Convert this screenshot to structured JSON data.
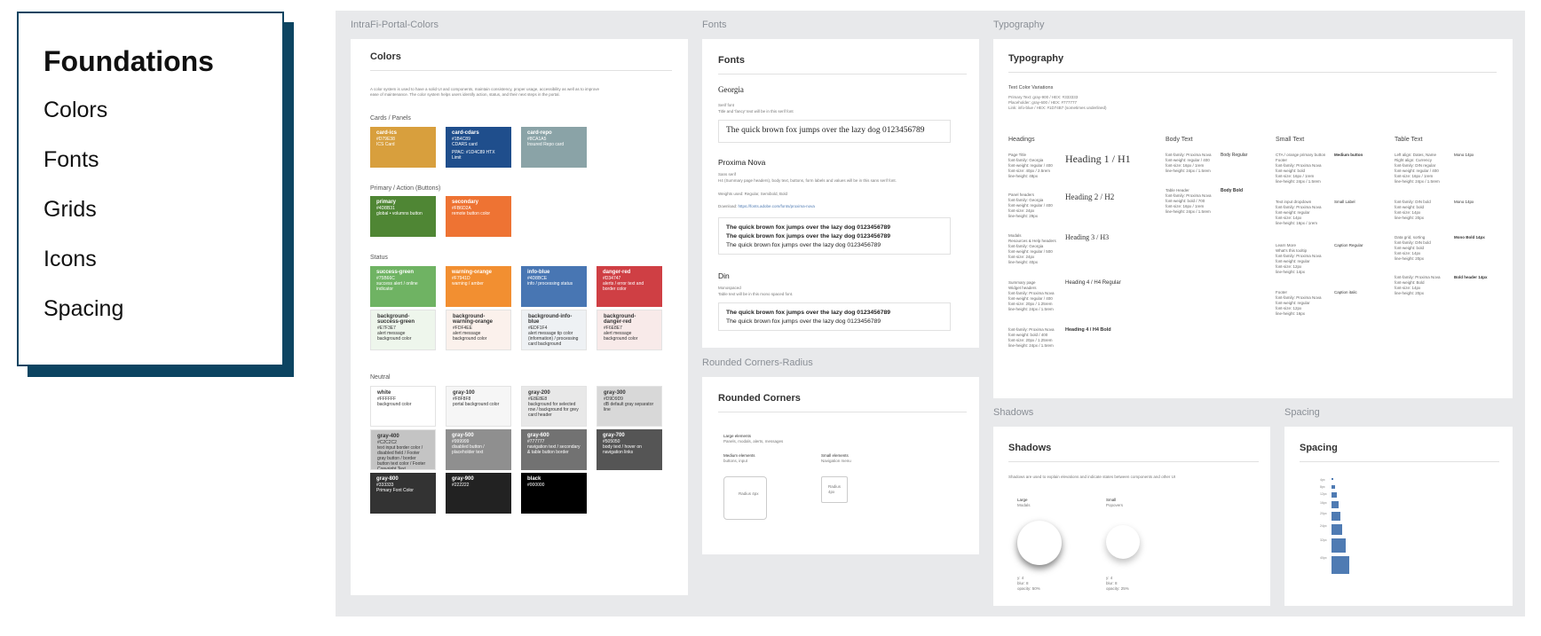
{
  "nav": {
    "title": "Foundations",
    "items": [
      "Colors",
      "Fonts",
      "Grids",
      "Icons",
      "Spacing"
    ]
  },
  "frames": {
    "colors": {
      "label": "IntraFi-Portal-Colors",
      "heading": "Colors",
      "intro": "A color system is used to have a solid UI and components, maintain consistency, proper usage, accessibility as well as to improve ease of maintenance. The color system helps users identify action, status, and their next steps in the portal.",
      "sections": {
        "cards": "Cards / Panels",
        "primary": "Primary / Action (Buttons)",
        "status": "Status",
        "neutral": "Neutral"
      },
      "cards": [
        {
          "name": "card-ics",
          "hex": "#D79E38",
          "note": "ICS Card",
          "color": "#d89f3d",
          "light": false
        },
        {
          "name": "card-cdars",
          "hex": "#1B4C89",
          "note": "CDARS card",
          "note2": "PPAC: #1D4C89 HTX Limit",
          "color": "#1f4e8c",
          "light": false
        },
        {
          "name": "card-repo",
          "hex": "#8CA1A5",
          "note": "Insured Repo card",
          "color": "#8aa3a7",
          "light": false
        }
      ],
      "primary": [
        {
          "name": "primary",
          "hex": "#4D8B31",
          "note": "global • volumns button",
          "color": "#4f8634",
          "light": false
        },
        {
          "name": "secondary",
          "hex": "#FB6D2A",
          "note": "remote button color",
          "color": "#ee7333",
          "light": false
        }
      ],
      "status": [
        {
          "name": "success-green",
          "hex": "#75B66C",
          "note": "success alert / online indicator",
          "color": "#6fb363",
          "light": false
        },
        {
          "name": "warning-orange",
          "hex": "#F7941D",
          "note": "warning / amber",
          "color": "#f28f31",
          "light": false
        },
        {
          "name": "info-blue",
          "hex": "#4D8BCE",
          "note": "info / processing status",
          "color": "#4876b3",
          "light": false
        },
        {
          "name": "danger-red",
          "hex": "#D34747",
          "note": "alerts / error text and border color",
          "color": "#cf3f44",
          "light": false
        }
      ],
      "status_bg": [
        {
          "name": "background-success-green",
          "hex": "#E7F3E7",
          "note": "alert message background color",
          "color": "#eef6ec",
          "light": true
        },
        {
          "name": "background-warning-orange",
          "hex": "#FDF4EE",
          "note": "alert message background color",
          "color": "#fbf1ec",
          "light": true
        },
        {
          "name": "background-info-blue",
          "hex": "#EDF1F4",
          "note": "alert message tip color (information) / processing card background",
          "color": "#eef1f4",
          "light": true
        },
        {
          "name": "background-danger-red",
          "hex": "#F6E8E7",
          "note": "alert message background color",
          "color": "#f8eae9",
          "light": true
        }
      ],
      "neutral": [
        {
          "name": "white",
          "hex": "#FFFFFF",
          "note": "background color",
          "color": "#ffffff",
          "light": true
        },
        {
          "name": "gray-100",
          "hex": "#F8F8F8",
          "note": "portal background color",
          "color": "#f6f6f6",
          "light": true
        },
        {
          "name": "gray-200",
          "hex": "#E8E8E8",
          "note": "background for selected row / background for grey card header",
          "color": "#e8e8e8",
          "light": true
        },
        {
          "name": "gray-300",
          "hex": "#D9D9D9",
          "note": "dB default gray separator line",
          "color": "#d8d8d8",
          "light": true
        },
        {
          "name": "gray-400",
          "hex": "#C2C2C2",
          "note": "text input border color / disabled field / Footer gray button / border button text color / Footer Copyright Text",
          "color": "#c4c4c4",
          "light": true
        },
        {
          "name": "gray-500",
          "hex": "#999999",
          "note": "disabled button / placeholder text",
          "color": "#8f8f8f",
          "light": false
        },
        {
          "name": "gray-600",
          "hex": "#777777",
          "note": "navigation text / secondary & table button border",
          "color": "#727272",
          "light": false
        },
        {
          "name": "gray-700",
          "hex": "#505050",
          "note": "body text / hover on navigation links",
          "color": "#555555",
          "light": false
        },
        {
          "name": "gray-800",
          "hex": "#333333",
          "note": "Primary Font Color",
          "color": "#333333",
          "light": false
        },
        {
          "name": "gray-900",
          "hex": "#222222",
          "note": "",
          "color": "#222222",
          "light": false
        },
        {
          "name": "black",
          "hex": "#000000",
          "note": "",
          "color": "#000000",
          "light": false
        }
      ]
    },
    "fonts": {
      "label": "Fonts",
      "heading": "Fonts",
      "georgia": {
        "name": "Georgia",
        "kind": "Serif font",
        "desc": "Title and 'fancy' text will be in this serif font",
        "sample": "The quick brown fox jumps over the lazy dog 0123456789"
      },
      "proxima": {
        "name": "Proxima Nova",
        "kind": "Sans serif",
        "desc": "H4 (Summary page headers), body text, buttons, form labels and values will be in this sans serif font.",
        "weights": "Weights used: Regular, Semibold, Bold",
        "download_label": "Download:",
        "download_link": "https://fonts.adobe.com/fonts/proxima-nova",
        "samples": [
          "The quick brown fox jumps over the lazy dog 0123456789",
          "The quick brown fox jumps over the lazy dog 0123456789",
          "The quick brown fox jumps over the lazy dog 0123456789"
        ]
      },
      "din": {
        "name": "Din",
        "kind": "Monospaced",
        "desc": "Table text will be in this mono spaced font.",
        "samples": [
          "The quick brown fox jumps over the lazy dog 0123456789",
          "The quick brown fox jumps over the lazy dog 0123456789"
        ]
      }
    },
    "rounded": {
      "label": "Rounded Corners-Radius",
      "heading": "Rounded Corners",
      "large_title": "Large elements",
      "large_desc": "Panels, modals, alerts, messages",
      "medium_title": "Medium elements",
      "medium_desc": "buttons, input",
      "small_title": "Small elements",
      "small_desc": "Navigation menu",
      "medium_box": "Radius 4px",
      "small_box": "Radius 4px"
    },
    "typography": {
      "label": "Typography",
      "heading": "Typography",
      "variations_title": "Text Color Variations",
      "variations": [
        "Primary Text: gray-900 / HEX: #333333",
        "Placeholder: gray-600 / HEX: #777777",
        "Link: info-blue / HEX: #1D74B7 (sometimes underlined)"
      ],
      "columns": [
        "Headings",
        "Body Text",
        "Small Text",
        "Table Text"
      ],
      "headings": [
        {
          "spec": [
            "Page Title",
            "font-family: Georgia",
            "font-weight: regular / 400",
            "font-size: 40px / 2.5rem",
            "line-height: 48px"
          ],
          "sample": "Heading 1 / H1"
        },
        {
          "spec": [
            "Panel headers",
            "font-family: Georgia",
            "font-weight: regular / 400",
            "font-size: 24px",
            "line-height: 29px"
          ],
          "sample": "Heading 2 / H2"
        },
        {
          "spec": [
            "Modals",
            "Resources & Help headers",
            "font-family: Georgia",
            "font-weight: regular / 500",
            "font-size: 24px",
            "line-height: 40px"
          ],
          "sample": "Heading 3 / H3"
        },
        {
          "spec": [
            "Summary page",
            "Widget headers",
            "font-family: Proxima Nova",
            "font-weight: regular / 400",
            "font-size: 20px / 1.25rem",
            "line-height: 24px / 1.5rem"
          ],
          "sample": "Heading 4 / H4 Regular"
        },
        {
          "spec": [
            "font-family: Proxima Nova",
            "font-weight: bold / 400",
            "font-size: 20px / 1.25rem",
            "line-height: 24px / 1.5rem"
          ],
          "sample": "Heading 4 / H4 Bold"
        }
      ],
      "body": [
        {
          "spec": [
            "font-family: Proxima Nova",
            "font-weight: regular / 400",
            "font-size: 16px / 1rem",
            "line-height: 24px / 1.5rem"
          ],
          "sample": "Body Regular"
        },
        {
          "spec": [
            "Table Header",
            "font-family: Proxima Nova",
            "font-weight: bold / 700",
            "font-size: 16px / 1rem",
            "line-height: 24px / 1.5rem"
          ],
          "sample": "Body Bold"
        }
      ],
      "small": [
        {
          "spec": [
            "CTA / orange primary button",
            "Footer",
            "font-family: Proxima Nova",
            "font-weight: bold",
            "font-size: 16px / 1rem",
            "line-height: 24px / 1.5rem"
          ],
          "sample": "Medium button"
        },
        {
          "spec": [
            "Text input dropdown",
            "font-family: Proxima Nova",
            "font-weight: regular",
            "font-size: 14px",
            "line-height: 16px / 1rem"
          ],
          "sample": "Small Label"
        },
        {
          "spec": [
            "Learn More",
            "What's this tooltip",
            "font-family: Proxima Nova",
            "font-weight: regular",
            "font-size: 12px",
            "line-height: 14px"
          ],
          "sample": "Caption Regular"
        },
        {
          "spec": [
            "Footer",
            "font-family: Proxima Nova",
            "font-weight: regular",
            "font-size: 12px",
            "line-height: 16px"
          ],
          "sample": "Caption italic"
        }
      ],
      "table": [
        {
          "spec": [
            "Left align: Dates, Name",
            "Right align: Currency",
            "font-family: DIN regular",
            "font-weight: regular / 400",
            "font-size: 16px / 1rem",
            "line-height: 24px / 1.5rem"
          ],
          "sample": "Mono 14px"
        },
        {
          "spec": [
            "font-family: DIN bold",
            "font-weight: bold",
            "font-size: 14px",
            "line-height: 20px"
          ],
          "sample": "Mono 14px"
        },
        {
          "spec": [
            "Data grid, sorting",
            "font-family: DIN bold",
            "font-weight: bold",
            "font-size: 14px",
            "line-height: 20px"
          ],
          "sample": "Mono Bold 14px"
        },
        {
          "spec": [
            "font-family: Proxima Nova",
            "font-weight: Bold",
            "font-size: 14px",
            "line-height: 20px"
          ],
          "sample": "Bold header 14px"
        }
      ]
    },
    "shadows": {
      "label": "Shadows",
      "heading": "Shadows",
      "desc": "Shadows are used to explain elevations and indicate states between components and other UI",
      "large": {
        "title": "Large",
        "sub": "Modals",
        "spec": [
          "y: 4",
          "blur: 8",
          "opacity: 50%"
        ]
      },
      "small": {
        "title": "Small",
        "sub": "Popovers",
        "spec": [
          "y: 4",
          "blur: 8",
          "opacity: 25%"
        ]
      }
    },
    "spacing": {
      "label": "Spacing",
      "heading": "Spacing",
      "sizes": [
        {
          "label": "4px",
          "size": 4
        },
        {
          "label": "8px",
          "size": 8
        },
        {
          "label": "12px",
          "size": 12
        },
        {
          "label": "16px",
          "size": 16
        },
        {
          "label": "20px",
          "size": 20
        },
        {
          "label": "24px",
          "size": 24
        },
        {
          "label": "32px",
          "size": 32
        },
        {
          "label": "40px",
          "size": 40
        }
      ]
    }
  }
}
